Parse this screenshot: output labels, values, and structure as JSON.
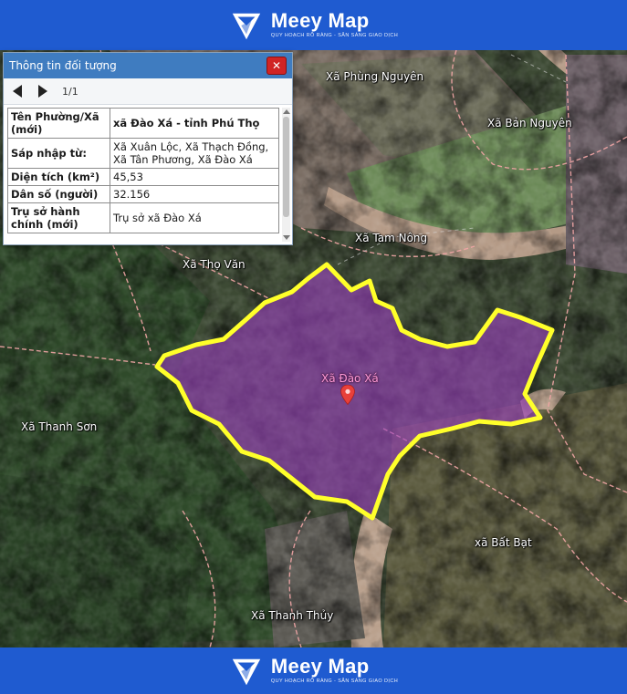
{
  "brand": {
    "name": "Meey Map",
    "tagline": "QUY HOẠCH RÕ RÀNG - SẴN SÀNG GIAO DỊCH"
  },
  "panel": {
    "title": "Thông tin đối tượng",
    "close": "✕",
    "pagination": "1/1",
    "rows": [
      {
        "key": "Tên Phường/Xã (mới)",
        "value": "xã Đào Xá - tỉnh Phú Thọ"
      },
      {
        "key": "Sáp nhập từ:",
        "value": "Xã Xuân Lộc, Xã Thạch Đồng, Xã Tân Phương, Xã Đào Xá"
      },
      {
        "key": "Diện tích (km²)",
        "value": "45,53"
      },
      {
        "key": "Dân số (người)",
        "value": "32.156"
      },
      {
        "key": "Trụ sở hành chính (mới)",
        "value": "Trụ sở xã Đào Xá"
      }
    ]
  },
  "map": {
    "labels": {
      "phung_nguyen": "Xã Phùng Nguyên",
      "ban_nguyen": "Xã Bản Nguyên",
      "tam_nong": "Xã Tam Nông",
      "tho_van": "Xã Thọ Văn",
      "thanh_son": "Xã Thanh Sơn",
      "dao_xa": "Xã Đào Xá",
      "bat_bat": "xã Bất Bạt",
      "thanh_thuy": "Xã Thanh Thủy"
    },
    "highlight_color": "#ffff2a",
    "fill_color": "#9b3fc0"
  }
}
